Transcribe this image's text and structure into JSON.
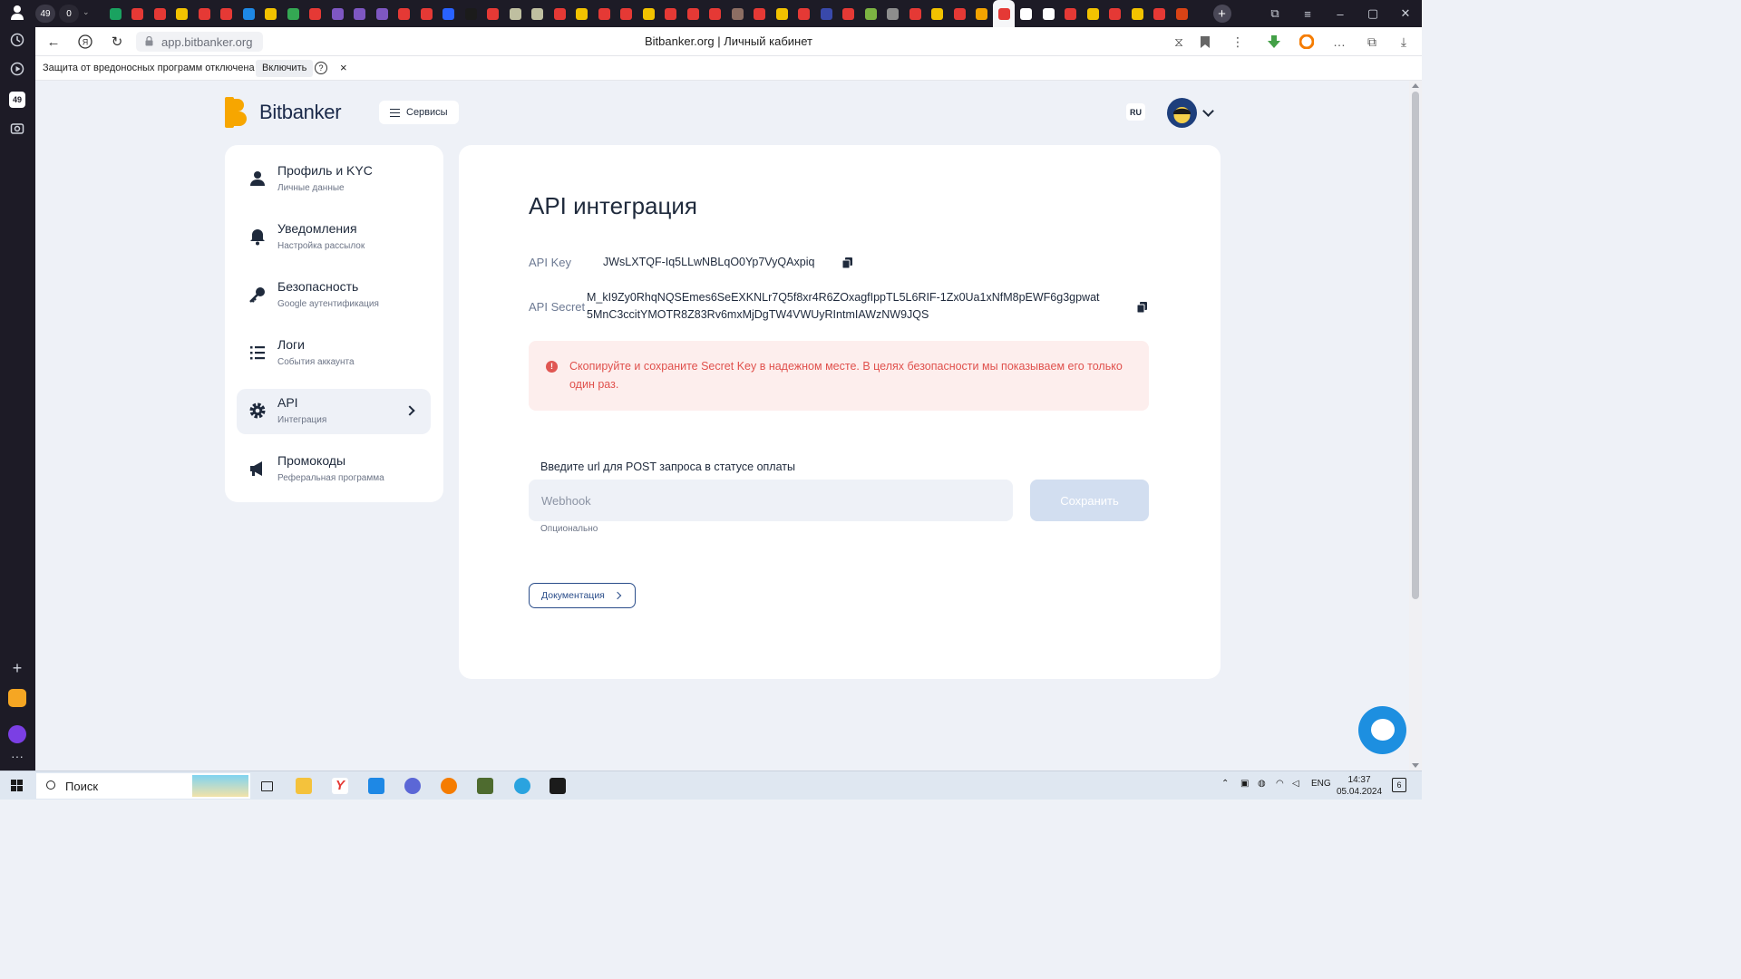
{
  "browser": {
    "tab_counter_1": "49",
    "tab_counter_2": "0",
    "sidebar_badge": "49",
    "url": "app.bitbanker.org",
    "page_title": "Bitbanker.org | Личный кабинет",
    "protection_text": "Защита от вредоносных программ отключена",
    "protection_enable": "Включить",
    "protection_help": "?",
    "protection_close": "×",
    "tab_colors": [
      "#1aa260",
      "#e53935",
      "#e53935",
      "#f2c200",
      "#e53935",
      "#e53935",
      "#1e88e5",
      "#f2c200",
      "#34a853",
      "#e53935",
      "#7e57c2",
      "#7e57c2",
      "#7e57c2",
      "#e53935",
      "#e53935",
      "#2962ff",
      "#1b1b1b",
      "#e53935",
      "#bfbfa0",
      "#bfbfa0",
      "#e53935",
      "#f2c200",
      "#e53935",
      "#e53935",
      "#f2c200",
      "#e53935",
      "#e53935",
      "#e53935",
      "#8d6e63",
      "#e53935",
      "#f2c200",
      "#e53935",
      "#3949ab",
      "#e53935",
      "#7cb342",
      "#8d8d8d",
      "#e53935",
      "#f2c200",
      "#e53935",
      "#f4a300",
      "#e53935",
      "#ffffff",
      "#ffffff",
      "#e53935",
      "#f2c200",
      "#e53935",
      "#f2c200",
      "#e53935",
      "#d84315"
    ]
  },
  "app": {
    "brand": "Bitbanker",
    "services_label": "Сервисы",
    "lang": "RU",
    "menu": [
      {
        "title": "Профиль и KYC",
        "subtitle": "Личные данные",
        "icon": "person-icon"
      },
      {
        "title": "Уведомления",
        "subtitle": "Настройка рассылок",
        "icon": "bell-icon"
      },
      {
        "title": "Безопасность",
        "subtitle": "Google аутентификация",
        "icon": "key-icon"
      },
      {
        "title": "Логи",
        "subtitle": "События аккаунта",
        "icon": "list-icon"
      },
      {
        "title": "API",
        "subtitle": "Интеграция",
        "icon": "gear-icon",
        "active": true
      },
      {
        "title": "Промокоды",
        "subtitle": "Реферальная программа",
        "icon": "megaphone-icon"
      }
    ],
    "main": {
      "heading": "API интеграция",
      "api_key_label": "API Key",
      "api_key_value": "JWsLXTQF-Iq5LLwNBLqO0Yp7VyQAxpiq",
      "api_secret_label": "API Secret",
      "api_secret_line1": "M_kI9Zy0RhqNQSEmes6SeEXKNLr7Q5f8xr4R6ZOxagfIppTL5L6RIF-1Zx0Ua1xNfM8pEWF6g3gpwat",
      "api_secret_line2": "5MnC3ccitYMOTR8Z83Rv6mxMjDgTW4VWUyRIntmIAWzNW9JQS",
      "alert_text": "Скопируйте и сохраните Secret Key в надежном месте. В целях безопасности мы показываем его только один раз.",
      "webhook_label": "Введите url для POST запроса в статусе оплаты",
      "webhook_placeholder": "Webhook",
      "webhook_value": "",
      "save_label": "Сохранить",
      "optional_hint": "Опционально",
      "docs_label": "Документация"
    },
    "colors": {
      "primary": "#1b3a78",
      "background": "#eef1f7",
      "alert_bg": "#fdeeed",
      "alert_text": "#e0514d",
      "logo_orange": "#f7a600"
    }
  },
  "taskbar": {
    "search_label": "Поиск",
    "lang": "ENG",
    "time": "14:37",
    "date": "05.04.2024",
    "notifications": "6"
  }
}
